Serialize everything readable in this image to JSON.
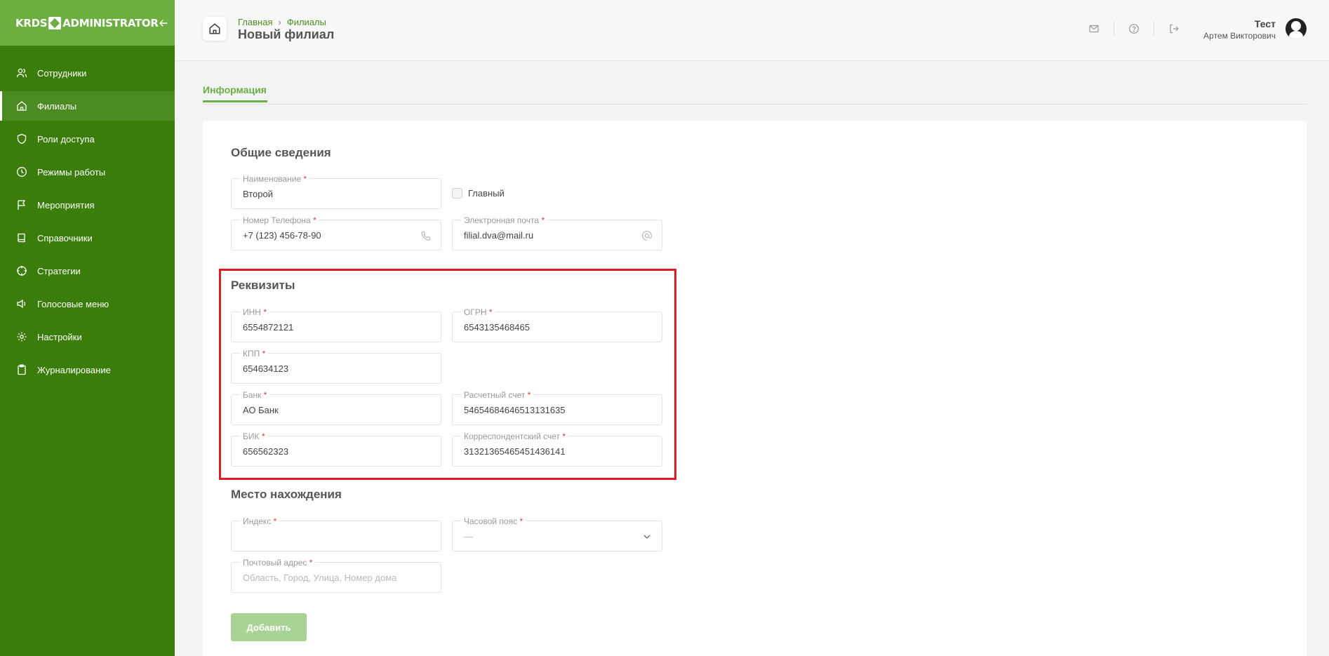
{
  "app": {
    "logo_left": "KRDS",
    "logo_right": "ADMINISTRATOR"
  },
  "sidebar": {
    "items": [
      {
        "label": "Сотрудники",
        "icon": "users-icon"
      },
      {
        "label": "Филиалы",
        "icon": "home-icon",
        "active": true
      },
      {
        "label": "Роли доступа",
        "icon": "shield-icon"
      },
      {
        "label": "Режимы работы",
        "icon": "clock-icon"
      },
      {
        "label": "Мероприятия",
        "icon": "flag-icon"
      },
      {
        "label": "Справочники",
        "icon": "book-icon"
      },
      {
        "label": "Стратегии",
        "icon": "crosshair-icon"
      },
      {
        "label": "Голосовые меню",
        "icon": "speaker-icon"
      },
      {
        "label": "Настройки",
        "icon": "gear-icon"
      },
      {
        "label": "Журналирование",
        "icon": "clipboard-icon"
      }
    ]
  },
  "header": {
    "breadcrumb": [
      "Главная",
      "Филиалы"
    ],
    "title": "Новый филиал",
    "user_name": "Тест",
    "user_sub": "Артем Викторович"
  },
  "tabs": {
    "active": "Информация"
  },
  "form": {
    "general": {
      "title": "Общие сведения",
      "name": {
        "label": "Наименование",
        "value": "Второй"
      },
      "main_checkbox": "Главный",
      "phone": {
        "label": "Номер Телефона",
        "value": "+7 (123) 456-78-90"
      },
      "email": {
        "label": "Электронная почта",
        "value": "filial.dva@mail.ru"
      }
    },
    "requisites": {
      "title": "Реквизиты",
      "inn": {
        "label": "ИНН",
        "value": "6554872121"
      },
      "ogrn": {
        "label": "ОГРН",
        "value": "6543135468465"
      },
      "kpp": {
        "label": "КПП",
        "value": "654634123"
      },
      "bank": {
        "label": "Банк",
        "value": "АО Банк"
      },
      "account": {
        "label": "Расчетный счет",
        "value": "54654684646513131635"
      },
      "bik": {
        "label": "БИК",
        "value": "656562323"
      },
      "corr_account": {
        "label": "Корреспондентский счет",
        "value": "31321365465451436141"
      }
    },
    "location": {
      "title": "Место нахождения",
      "index": {
        "label": "Индекс",
        "value": ""
      },
      "timezone": {
        "label": "Часовой пояс",
        "value": "—"
      },
      "address": {
        "label": "Почтовый адрес",
        "placeholder": "Область, Город, Улица, Номер дома"
      }
    },
    "submit_label": "Добавить"
  },
  "required_mark": "*",
  "colors": {
    "sidebar": "#3b7d0b",
    "sidebar_top": "#6cae40",
    "accent": "#6cae40",
    "highlight": "#e01b24"
  }
}
